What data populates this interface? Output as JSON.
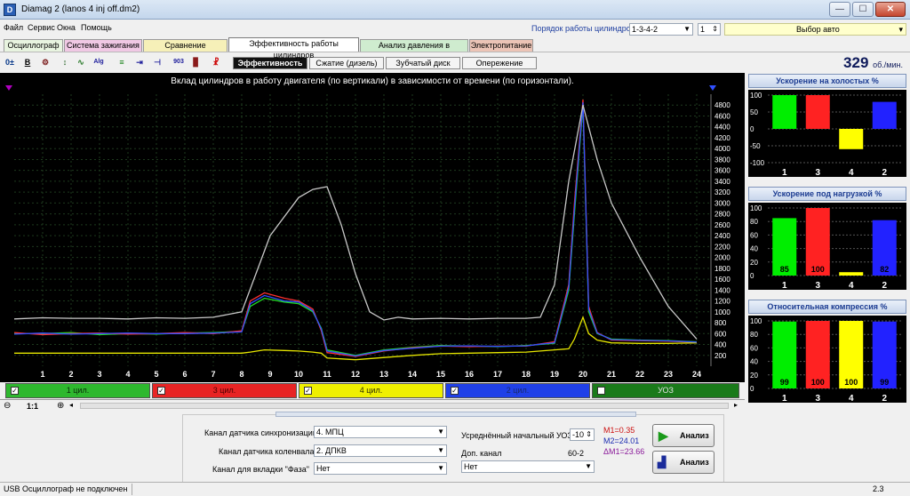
{
  "window": {
    "title": "Diamag 2 (lanos 4 inj off.dm2)",
    "controls": {
      "minimize": "—",
      "maximize": "☐",
      "close": "✕"
    }
  },
  "menu": [
    "Файл",
    "Сервис",
    "Окна",
    "Помощь"
  ],
  "header": {
    "order_label": "Порядок работы цилиндров",
    "order_value": "1-3-4-2",
    "order_num": "1",
    "auto_select": "Выбор авто"
  },
  "tabs": [
    {
      "label": "Осциллограф",
      "color": "#e8f4e0"
    },
    {
      "label": "Система зажигания",
      "color": "#f0c8e4"
    },
    {
      "label": "Сравнение цилиндров",
      "color": "#f6f0b8"
    },
    {
      "label": "Эффективность работы цилиндров",
      "color": "#ffffff"
    },
    {
      "label": "Анализ давления в цилиндре",
      "color": "#cfeccf"
    },
    {
      "label": "Электропитание",
      "color": "#ecc4b6"
    }
  ],
  "subtabs": [
    "Эффективность",
    "Сжатие (дизель)",
    "Зубчатый диск",
    "Опережение"
  ],
  "toolbar_icons": [
    "0±",
    "B",
    "⚙",
    "↕",
    "∿",
    "Alg",
    "≡",
    "⇥",
    "⊣",
    "903",
    "▊",
    "☧"
  ],
  "rpm": {
    "value": "329",
    "unit": "об./мин."
  },
  "plot": {
    "title": "Вклад цилиндров в работу двигателя (по вертикали) в зависимости от времени (по горизонтали)."
  },
  "chart_data": [
    {
      "type": "line",
      "title": "Вклад цилиндров в работу двигателя (по вертикали) в зависимости от времени (по горизонтали).",
      "xlabel": "",
      "ylabel": "",
      "xlim": [
        0,
        24.5
      ],
      "ylim": [
        0,
        5000
      ],
      "x_ticks": [
        1,
        2,
        3,
        4,
        5,
        6,
        7,
        8,
        9,
        10,
        11,
        12,
        13,
        14,
        15,
        16,
        17,
        18,
        19,
        20,
        21,
        22,
        23,
        24
      ],
      "y_ticks": [
        200,
        400,
        600,
        800,
        1000,
        1200,
        1400,
        1600,
        1800,
        2000,
        2200,
        2400,
        2600,
        2800,
        3000,
        3200,
        3400,
        3600,
        3800,
        4000,
        4200,
        4400,
        4600,
        4800
      ],
      "grid": true,
      "series": [
        {
          "name": "1 цил.",
          "color": "#22dd22",
          "x": [
            0,
            1,
            2,
            3,
            4,
            5,
            6,
            7,
            8,
            8.3,
            8.8,
            9.5,
            10,
            10.5,
            10.8,
            11,
            12,
            13,
            14,
            15,
            16,
            17,
            18,
            18.5,
            19,
            19.5,
            19.7,
            20,
            20.2,
            20.5,
            21,
            22,
            23,
            24
          ],
          "y": [
            600,
            600,
            620,
            580,
            600,
            590,
            610,
            620,
            640,
            1100,
            1250,
            1180,
            1150,
            1000,
            700,
            300,
            200,
            300,
            350,
            380,
            370,
            360,
            380,
            400,
            420,
            1400,
            2800,
            4800,
            1000,
            600,
            500,
            480,
            470,
            450
          ]
        },
        {
          "name": "3 цил.",
          "color": "#ff3030",
          "x": [
            0,
            1,
            2,
            3,
            4,
            5,
            6,
            7,
            8,
            8.3,
            8.8,
            9.5,
            10,
            10.5,
            10.8,
            11,
            12,
            13,
            14,
            15,
            16,
            17,
            18,
            18.5,
            19,
            19.5,
            19.7,
            20,
            20.2,
            20.5,
            21,
            22,
            23,
            24
          ],
          "y": [
            620,
            580,
            600,
            610,
            590,
            600,
            620,
            600,
            650,
            1200,
            1350,
            1250,
            1200,
            1050,
            650,
            250,
            180,
            280,
            340,
            370,
            360,
            370,
            370,
            410,
            450,
            1500,
            3000,
            4900,
            1100,
            620,
            480,
            470,
            460,
            440
          ]
        },
        {
          "name": "4 цил.",
          "color": "#e6e600",
          "x": [
            0,
            1,
            2,
            3,
            4,
            5,
            6,
            7,
            8,
            8.3,
            8.8,
            9.5,
            10,
            10.5,
            10.8,
            11,
            12,
            13,
            14,
            15,
            16,
            17,
            18,
            18.5,
            19,
            19.5,
            19.7,
            20,
            20.2,
            20.5,
            21,
            22,
            23,
            24
          ],
          "y": [
            240,
            240,
            240,
            240,
            240,
            240,
            240,
            240,
            240,
            260,
            300,
            290,
            280,
            260,
            240,
            150,
            120,
            160,
            200,
            230,
            240,
            250,
            260,
            280,
            300,
            320,
            500,
            900,
            600,
            480,
            430,
            420,
            420,
            430
          ]
        },
        {
          "name": "2 цил.",
          "color": "#3050ff",
          "x": [
            0,
            1,
            2,
            3,
            4,
            5,
            6,
            7,
            8,
            8.3,
            8.8,
            9.5,
            10,
            10.5,
            10.8,
            11,
            12,
            13,
            14,
            15,
            16,
            17,
            18,
            18.5,
            19,
            19.5,
            19.7,
            20,
            20.2,
            20.5,
            21,
            22,
            23,
            24
          ],
          "y": [
            590,
            610,
            590,
            600,
            610,
            600,
            600,
            610,
            630,
            1150,
            1300,
            1200,
            1180,
            1020,
            680,
            280,
            190,
            290,
            330,
            370,
            375,
            365,
            375,
            405,
            430,
            1450,
            2900,
            4850,
            1050,
            610,
            490,
            475,
            465,
            445
          ]
        },
        {
          "name": "УОЗ",
          "color": "#c8c8c8",
          "x": [
            0,
            1,
            2,
            3,
            4,
            5,
            6,
            7,
            8,
            8.5,
            9,
            10,
            10.5,
            11,
            11.5,
            12,
            12.5,
            13,
            13.5,
            14,
            15,
            16,
            17,
            18,
            18.5,
            19,
            19.5,
            20,
            20.5,
            21,
            22,
            23,
            24
          ],
          "y": [
            870,
            890,
            880,
            880,
            870,
            890,
            880,
            900,
            1000,
            1700,
            2400,
            3100,
            3250,
            3300,
            2600,
            1700,
            1000,
            850,
            900,
            870,
            880,
            870,
            880,
            880,
            900,
            1500,
            3400,
            4800,
            3800,
            3000,
            2000,
            1100,
            500
          ]
        }
      ]
    },
    {
      "type": "bar",
      "title": "Ускорение на холостых %",
      "categories": [
        "1",
        "3",
        "4",
        "2"
      ],
      "values": [
        100,
        100,
        -60,
        80
      ],
      "colors": [
        "#00ee00",
        "#ff2222",
        "#ffff00",
        "#2222ff"
      ],
      "ylim": [
        -100,
        100
      ],
      "y_ticks": [
        -100,
        -50,
        0,
        50,
        100
      ]
    },
    {
      "type": "bar",
      "title": "Ускорение под нагрузкой %",
      "categories": [
        "1",
        "3",
        "4",
        "2"
      ],
      "values": [
        85,
        100,
        5,
        82
      ],
      "value_labels": [
        "85",
        "100",
        "",
        "82"
      ],
      "colors": [
        "#00ee00",
        "#ff2222",
        "#ffff00",
        "#2222ff"
      ],
      "ylim": [
        0,
        100
      ],
      "y_ticks": [
        0,
        20,
        40,
        60,
        80,
        100
      ]
    },
    {
      "type": "bar",
      "title": "Относительная компрессия %",
      "categories": [
        "1",
        "3",
        "4",
        "2"
      ],
      "values": [
        99,
        100,
        100,
        99
      ],
      "value_labels": [
        "99",
        "100",
        "100",
        "99"
      ],
      "colors": [
        "#00ee00",
        "#ff2222",
        "#ffff00",
        "#2222ff"
      ],
      "ylim": [
        0,
        100
      ],
      "y_ticks": [
        0,
        20,
        40,
        60,
        80,
        100
      ]
    }
  ],
  "cylinders": [
    {
      "label": "1 цил.",
      "bg": "#2eb82e",
      "fg": "#0a2a0a",
      "checked": true
    },
    {
      "label": "3 цил.",
      "bg": "#e82424",
      "fg": "#4a0000",
      "checked": true
    },
    {
      "label": "4 цил.",
      "bg": "#f0f000",
      "fg": "#2a2a00",
      "checked": true
    },
    {
      "label": "2 цил.",
      "bg": "#2040e8",
      "fg": "#1a2a6a",
      "checked": true
    },
    {
      "label": "УОЗ",
      "bg": "#1a7a1a",
      "fg": "#e0e0e0",
      "checked": false
    }
  ],
  "zoom": {
    "value": "1:1"
  },
  "bottom": {
    "sync_label": "Канал датчика синхронизации",
    "sync_value": "4. МПЦ",
    "crank_label": "Канал датчика коленвала",
    "crank_value": "2. ДПКВ",
    "phase_label": "Канал для вкладки \"Фаза\"",
    "phase_value": "Нет",
    "uoz_label": "Усреднённый начальный УОЗ",
    "uoz_value": "-10",
    "dop_label": "Доп. канал",
    "dop_value": "60-2",
    "dop_select": "Нет",
    "m1": "M1=0.35",
    "m2": "M2=24.01",
    "dm": "ΔM1=23.66",
    "analyze1": "Анализ",
    "analyze2": "Анализ"
  },
  "status": {
    "text": "USB Осциллограф не подключен",
    "right": "2.3"
  }
}
